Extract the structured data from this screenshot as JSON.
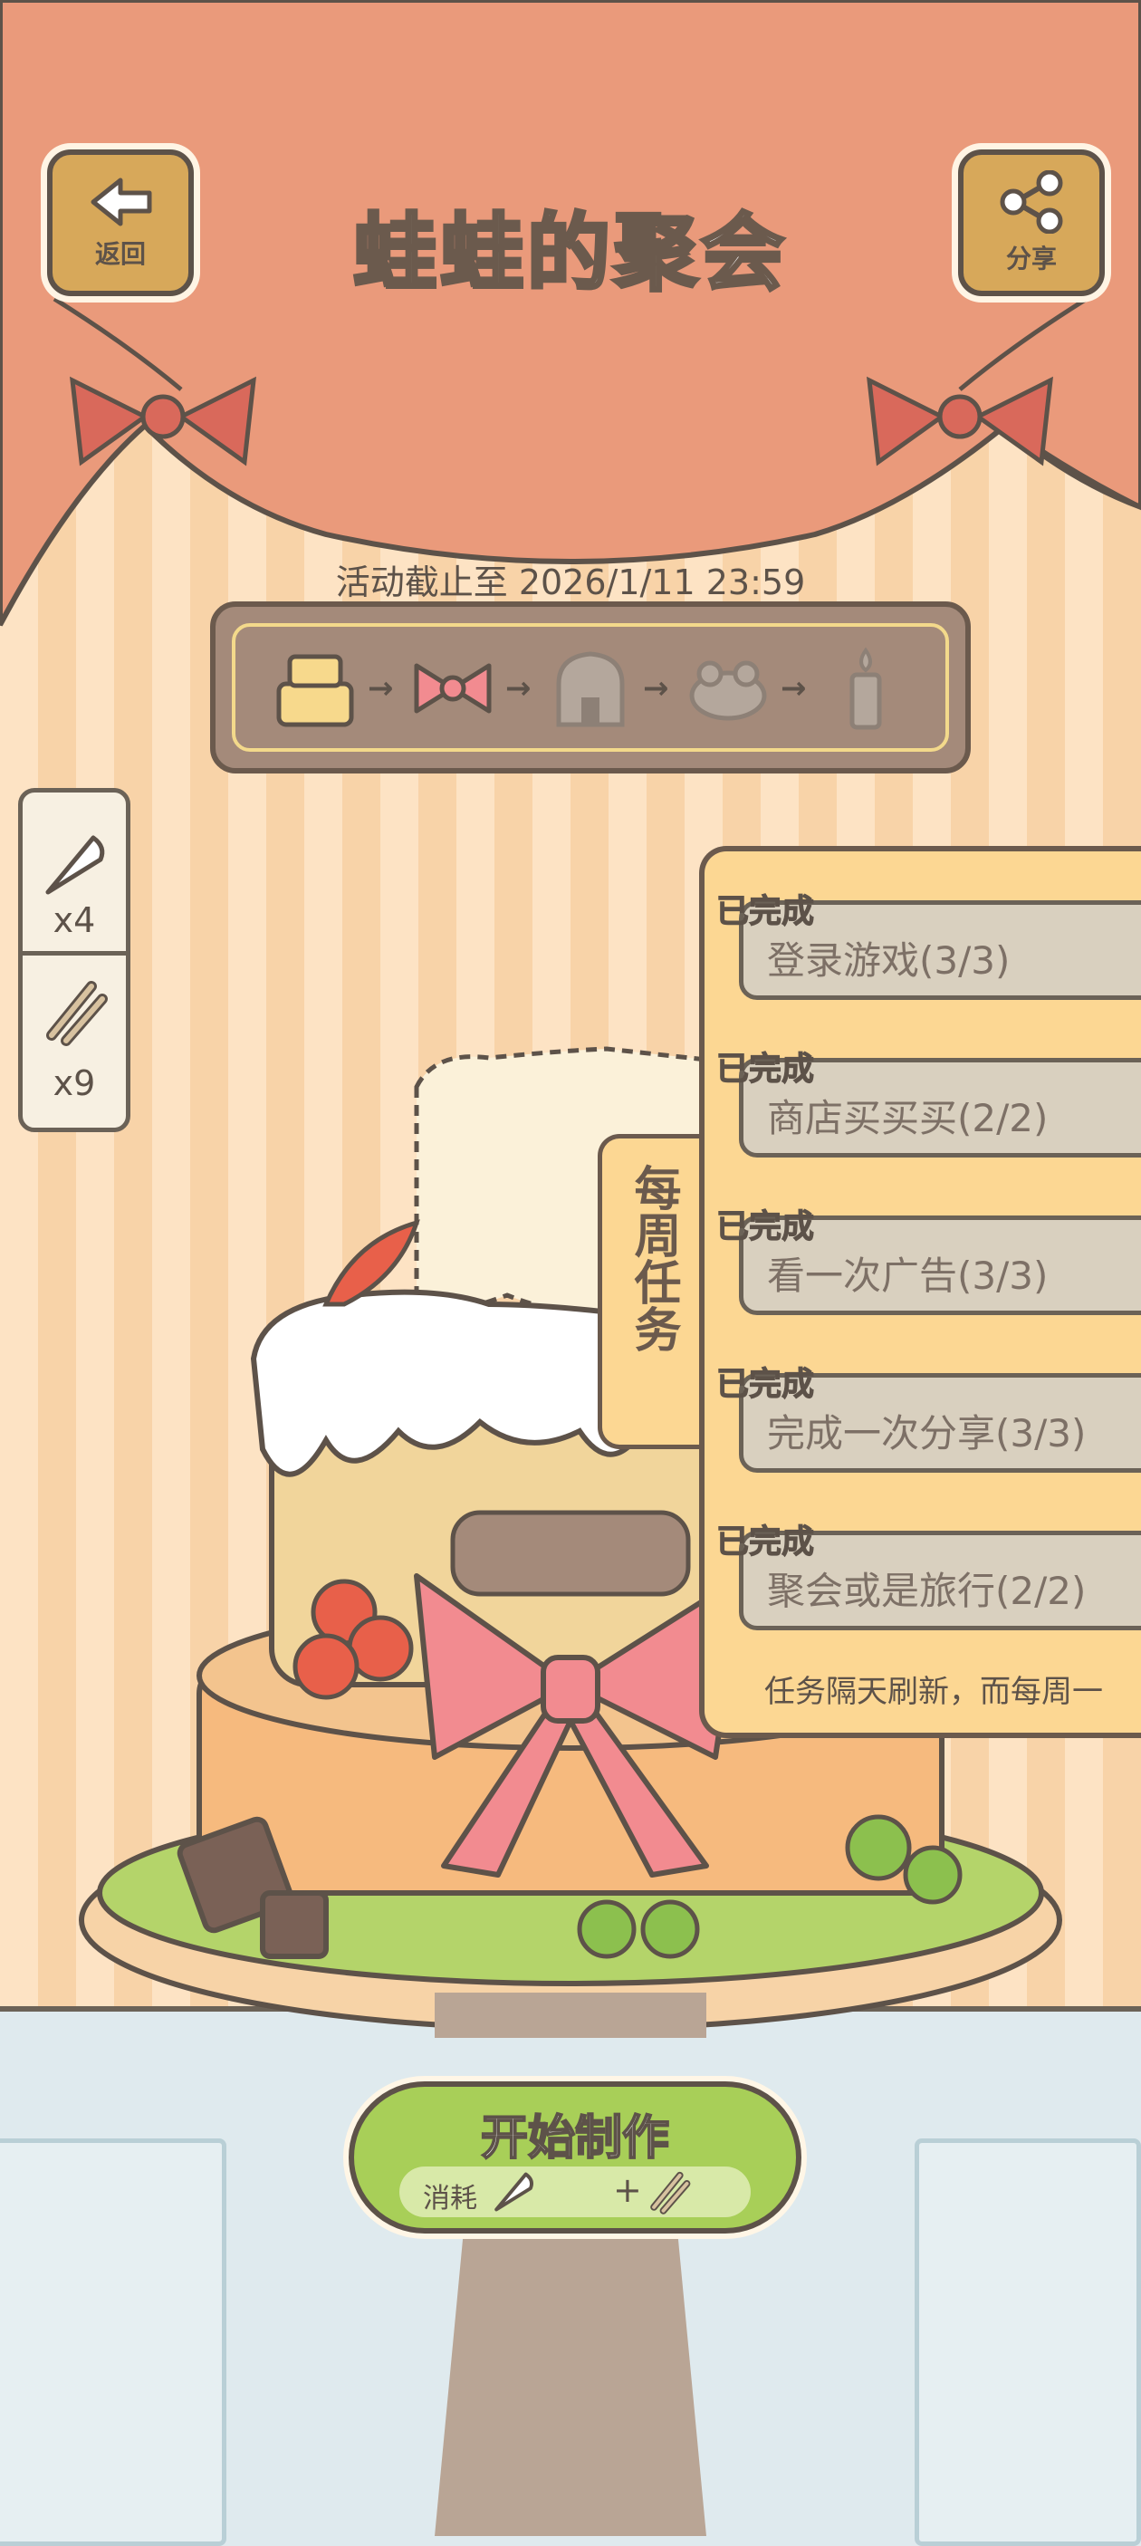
{
  "header": {
    "title": "蛙蛙的聚会",
    "back_label": "返回",
    "share_label": "分享"
  },
  "event": {
    "deadline_text": "活动截止至 2026/1/11 23:59",
    "progress_steps": [
      "cake-base-icon",
      "bow-icon",
      "house-icon",
      "frog-icon",
      "candle-icon"
    ],
    "progress_current": 2
  },
  "inventory": [
    {
      "icon": "piping-bag-icon",
      "count": "x4"
    },
    {
      "icon": "tools-icon",
      "count": "x9"
    }
  ],
  "weekly_tasks": {
    "tab_label": "每周任务",
    "tasks": [
      {
        "status": "已完成",
        "text": "登录游戏(3/3)"
      },
      {
        "status": "已完成",
        "text": "商店买买买(2/2)"
      },
      {
        "status": "已完成",
        "text": "看一次广告(3/3)"
      },
      {
        "status": "已完成",
        "text": "完成一次分享(3/3)"
      },
      {
        "status": "已完成",
        "text": "聚会或是旅行(2/2)"
      }
    ],
    "refresh_note": "任务隔天刷新，而每周一"
  },
  "start_button": {
    "label": "开始制作",
    "cost_label": "消耗",
    "plus": "+"
  },
  "colors": {
    "curtain": "#ea9a7b",
    "bow": "#d9695b",
    "panel": "#fcd793",
    "button_green": "#a8cf58",
    "outline": "#5d5249"
  }
}
